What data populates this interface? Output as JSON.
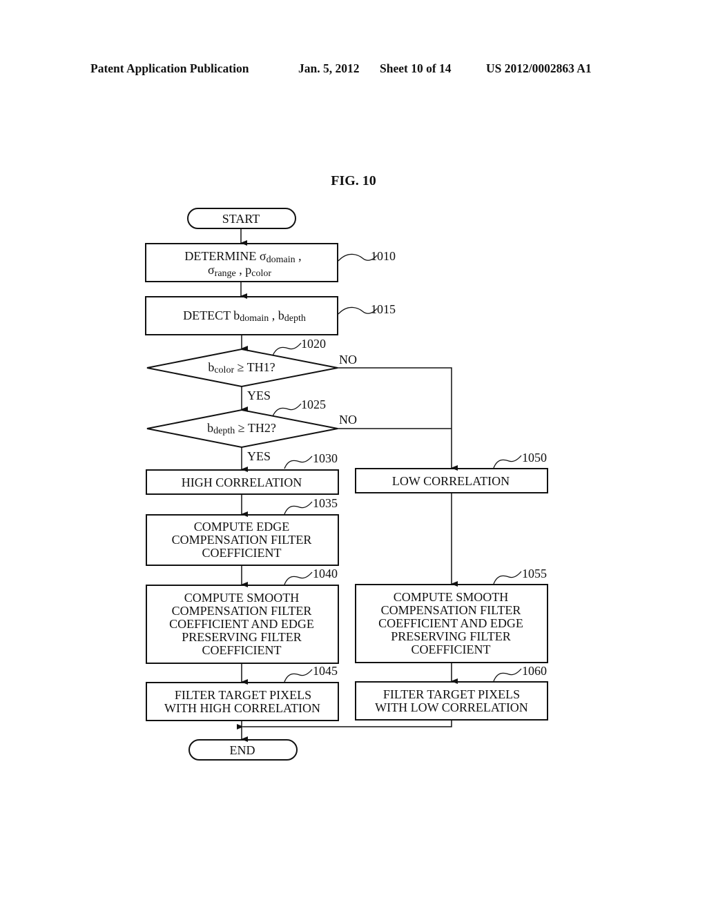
{
  "header": {
    "publication": "Patent Application Publication",
    "date": "Jan. 5, 2012",
    "sheet": "Sheet 10 of 14",
    "number": "US 2012/0002863 A1"
  },
  "figure": {
    "title": "FIG. 10"
  },
  "flowchart": {
    "start": "START",
    "end": "END",
    "steps": {
      "s1010": {
        "ref": "1010",
        "line1_prefix": "DETERMINE σ",
        "line1_sub": "domain",
        "line1_suffix": " ,",
        "line2_a": "σ",
        "line2_a_sub": "range",
        "line2_mid": " , p",
        "line2_b_sub": "color"
      },
      "s1015": {
        "ref": "1015",
        "prefix": "DETECT  b",
        "sub1": "domain",
        "mid": " , b",
        "sub2": "depth"
      },
      "s1020": {
        "ref": "1020",
        "prefix": "b",
        "sub": "color",
        "suffix": "  ≥ TH1?",
        "yes": "YES",
        "no": "NO"
      },
      "s1025": {
        "ref": "1025",
        "prefix": "b",
        "sub": "depth",
        "suffix": "  ≥ TH2?",
        "yes": "YES",
        "no": "NO"
      },
      "s1030": {
        "ref": "1030",
        "lines": [
          "HIGH CORRELATION"
        ]
      },
      "s1035": {
        "ref": "1035",
        "lines": [
          "COMPUTE EDGE",
          "COMPENSATION FILTER",
          "COEFFICIENT"
        ]
      },
      "s1040": {
        "ref": "1040",
        "lines": [
          "COMPUTE SMOOTH",
          "COMPENSATION FILTER",
          "COEFFICIENT AND EDGE",
          "PRESERVING FILTER",
          "COEFFICIENT"
        ]
      },
      "s1045": {
        "ref": "1045",
        "lines": [
          "FILTER TARGET PIXELS",
          "WITH HIGH CORRELATION"
        ]
      },
      "s1050": {
        "ref": "1050",
        "lines": [
          "LOW CORRELATION"
        ]
      },
      "s1055": {
        "ref": "1055",
        "lines": [
          "COMPUTE SMOOTH",
          "COMPENSATION FILTER",
          "COEFFICIENT AND EDGE",
          "PRESERVING FILTER",
          "COEFFICIENT"
        ]
      },
      "s1060": {
        "ref": "1060",
        "lines": [
          "FILTER TARGET PIXELS",
          "WITH LOW CORRELATION"
        ]
      }
    }
  }
}
